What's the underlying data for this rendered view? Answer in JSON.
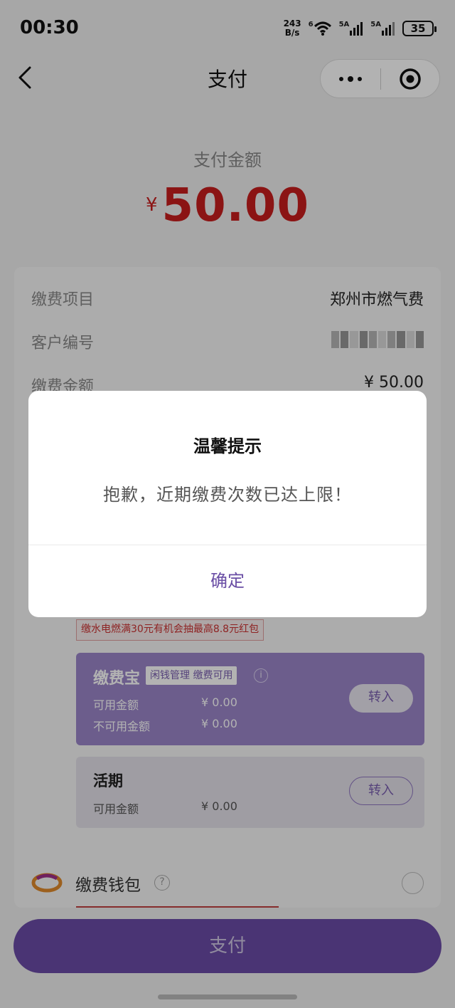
{
  "status_bar": {
    "time": "00:30",
    "net_speed_value": "243",
    "net_speed_unit": "B/s",
    "wifi_label": "6",
    "signal1_label": "5A",
    "signal2_label": "5A",
    "battery": "35"
  },
  "nav": {
    "title": "支付",
    "back_icon": "chevron-left-icon",
    "more_icon": "more-dots-icon",
    "target_icon": "target-icon"
  },
  "payment": {
    "amount_label": "支付金额",
    "currency": "¥",
    "amount": "50.00"
  },
  "details": {
    "item_label": "缴费项目",
    "item_value": "郑州市燃气费",
    "customer_label": "客户编号",
    "amount_label": "缴费金额",
    "amount_value": "¥ 50.00"
  },
  "promo": "缴水电燃满30元有机会抽最高8.8元红包",
  "jiaofeibao": {
    "title": "缴费宝",
    "tag": "闲钱管理 缴费可用",
    "available_label": "可用金额",
    "available_value": "¥ 0.00",
    "unavailable_label": "不可用金额",
    "unavailable_value": "¥ 0.00",
    "transfer_label": "转入"
  },
  "huoqi": {
    "title": "活期",
    "available_label": "可用金额",
    "available_value": "¥ 0.00",
    "transfer_label": "转入"
  },
  "wallet": {
    "label": "缴费钱包",
    "help": "?"
  },
  "pay_button": "支付",
  "modal": {
    "title": "温馨提示",
    "message": "抱歉，近期缴费次数已达上限！",
    "confirm": "确定"
  },
  "colors": {
    "brand_purple": "#6b4ba6",
    "amount_red": "#c81e1e",
    "confirm_purple": "#6a4ea5"
  }
}
